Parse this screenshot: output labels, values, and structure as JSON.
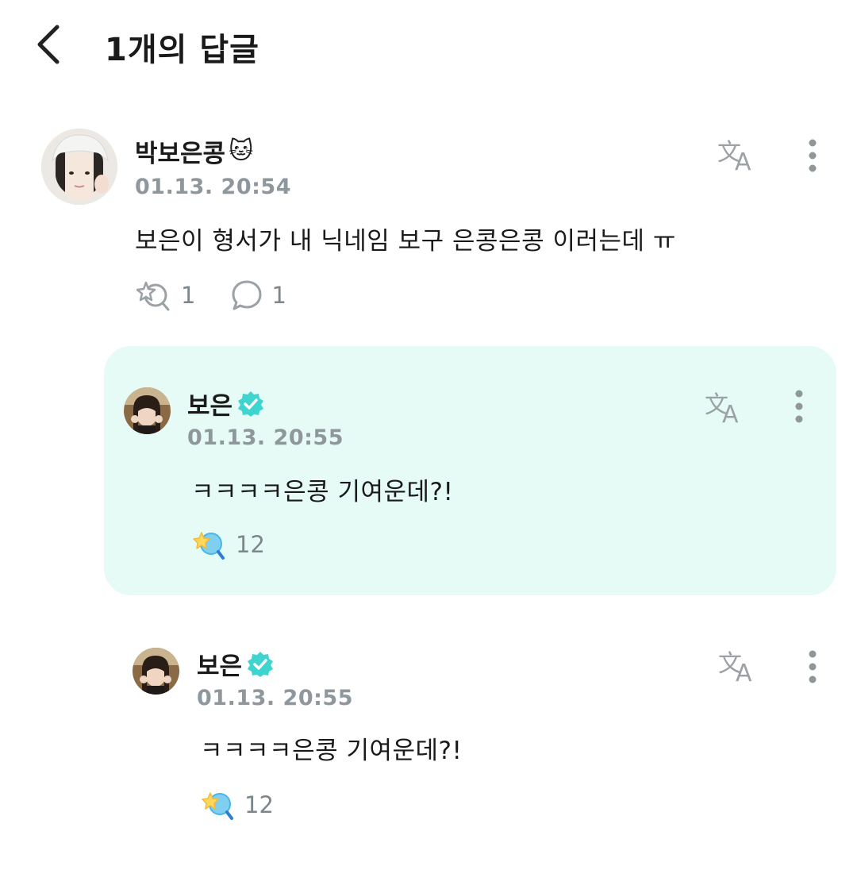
{
  "header": {
    "back_icon": "chevron-left-icon",
    "title": "1개의 답글"
  },
  "parent_comment": {
    "username": "박보은콩",
    "username_emoji": "🐱",
    "timestamp": "01.13. 20:54",
    "text": "보은이 형서가 내 닉네임 보구 은콩은콩 이러는데 ㅠ",
    "like_icon": "sparkle-like-outline-icon",
    "like_count": "1",
    "reply_icon": "speech-bubble-icon",
    "reply_count": "1"
  },
  "replies": [
    {
      "username": "보은",
      "verified": true,
      "timestamp": "01.13. 20:55",
      "text": "ㅋㅋㅋㅋ은콩 기여운데?!",
      "like_icon": "sparkle-like-filled-icon",
      "like_count": "12",
      "highlighted": true
    },
    {
      "username": "보은",
      "verified": true,
      "timestamp": "01.13. 20:55",
      "text": "ㅋㅋㅋㅋ은콩 기여운데?!",
      "like_icon": "sparkle-like-filled-icon",
      "like_count": "12",
      "highlighted": false
    }
  ],
  "colors": {
    "highlight_bg": "#e6fbf6",
    "verified_badge": "#3ed4d0",
    "timestamp": "#8e979c",
    "icon_gray": "#9aa2a6"
  }
}
